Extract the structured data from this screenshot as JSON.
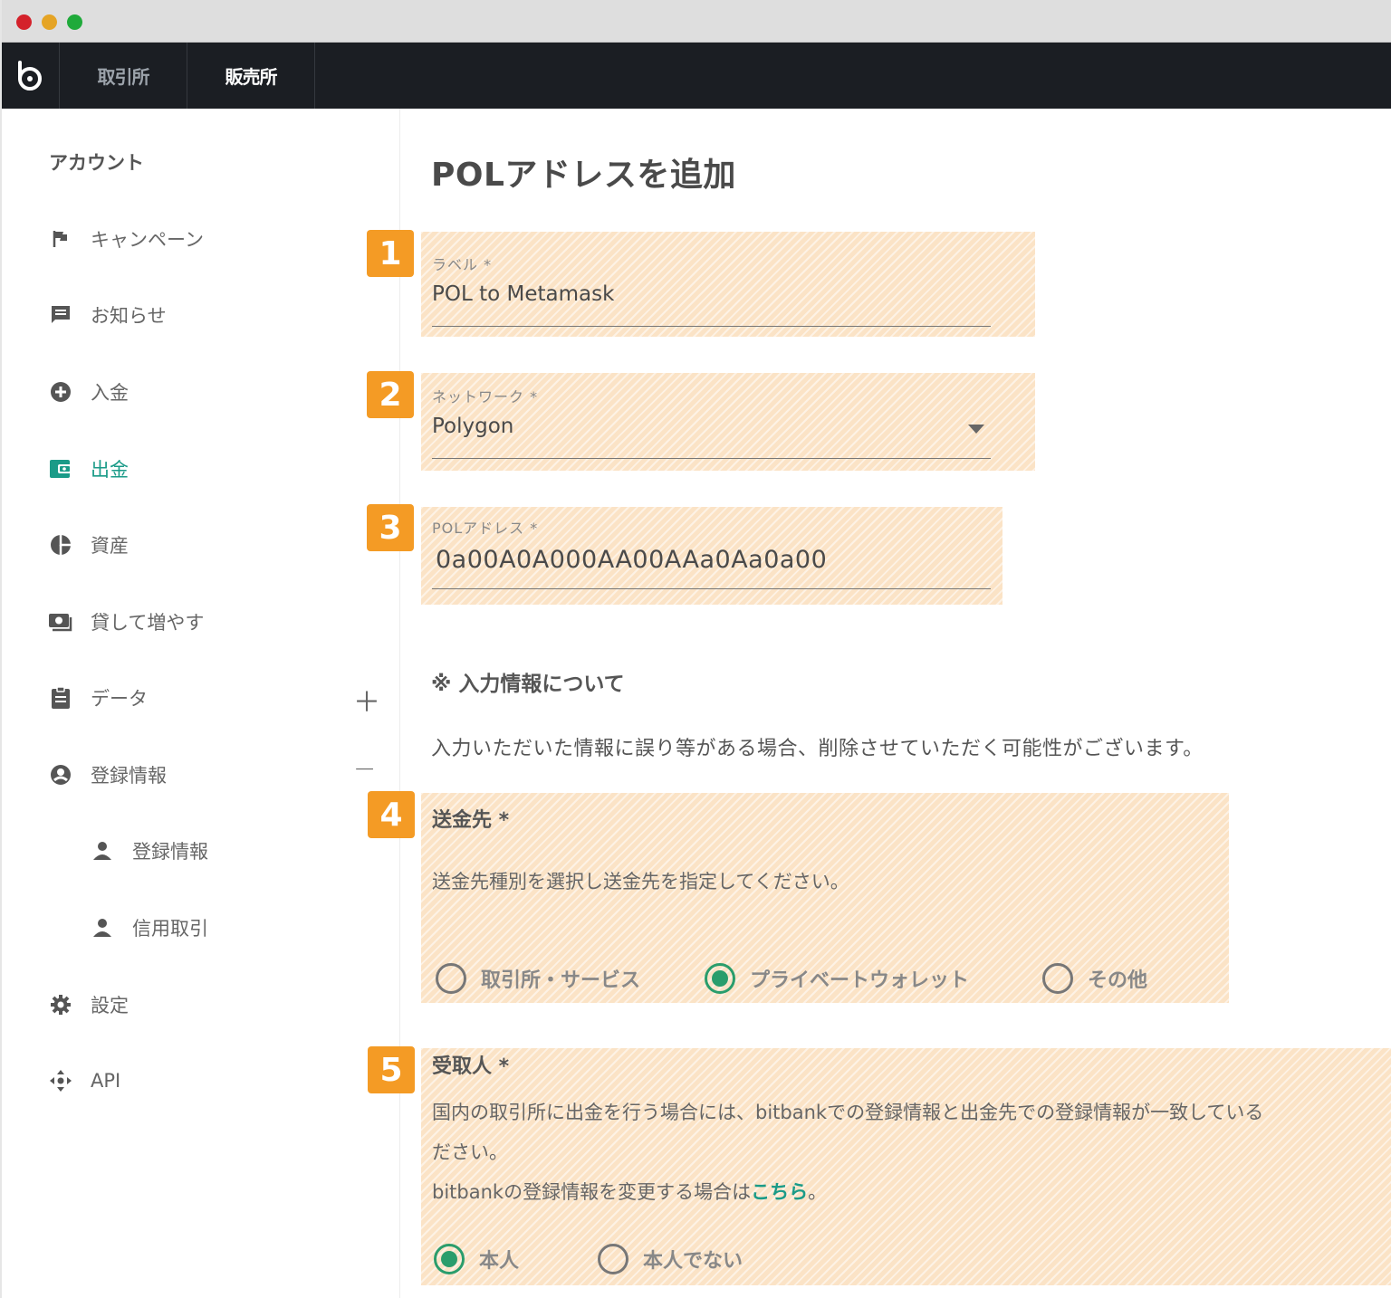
{
  "window": {
    "controls": [
      "close",
      "minimize",
      "maximize"
    ]
  },
  "topnav": {
    "logo_icon": "bitbank-logo-icon",
    "tabs": [
      {
        "label": "取引所"
      },
      {
        "label": "販売所",
        "active": true
      }
    ]
  },
  "sidebar": {
    "title": "アカウント",
    "items": [
      {
        "label": "キャンペーン",
        "icon": "flag-icon"
      },
      {
        "label": "お知らせ",
        "icon": "message-icon"
      },
      {
        "label": "入金",
        "icon": "add-circle-icon"
      },
      {
        "label": "出金",
        "icon": "wallet-icon",
        "active": true
      },
      {
        "label": "資産",
        "icon": "pie-chart-icon"
      },
      {
        "label": "貸して増やす",
        "icon": "money-icon"
      },
      {
        "label": "データ",
        "icon": "clipboard-icon",
        "toggle": "＋"
      },
      {
        "label": "登録情報",
        "icon": "account-circle-icon",
        "toggle": "−"
      },
      {
        "label": "登録情報",
        "icon": "person-icon",
        "sub": true
      },
      {
        "label": "信用取引",
        "icon": "person-icon",
        "sub": true
      },
      {
        "label": "設定",
        "icon": "gear-icon"
      },
      {
        "label": "API",
        "icon": "api-icon"
      }
    ]
  },
  "main": {
    "title": "POLアドレスを追加",
    "badges": [
      "1",
      "2",
      "3",
      "4",
      "5"
    ],
    "label_field": {
      "label": "ラベル *",
      "value": "POL to Metamask"
    },
    "network_field": {
      "label": "ネットワーク *",
      "value": "Polygon"
    },
    "address_field": {
      "label": "POLアドレス *",
      "value": "0a00A0A000AA00AAa0Aa0a00"
    },
    "note": {
      "heading": "※ 入力情報について",
      "body": "入力いただいた情報に誤り等がある場合、削除させていただく可能性がございます。"
    },
    "destination": {
      "title": "送金先 *",
      "instruction": "送金先種別を選択し送金先を指定してください。",
      "options": [
        {
          "label": "取引所・サービス",
          "selected": false
        },
        {
          "label": "プライベートウォレット",
          "selected": true
        },
        {
          "label": "その他",
          "selected": false
        }
      ]
    },
    "recipient": {
      "title": "受取人 *",
      "line1": "国内の取引所に出金を行う場合には、bitbankでの登録情報と出金先での登録情報が一致している",
      "line2": "ださい。",
      "line3_prefix": "bitbankの登録情報を変更する場合は",
      "line3_link": "こちら",
      "line3_suffix": "。",
      "options": [
        {
          "label": "本人",
          "selected": true
        },
        {
          "label": "本人でない",
          "selected": false
        }
      ]
    }
  },
  "colors": {
    "accent": "#1a9b88",
    "badge": "#f49b25",
    "highlight": "#fbe3c6",
    "nav_bg": "#1b1e23"
  }
}
